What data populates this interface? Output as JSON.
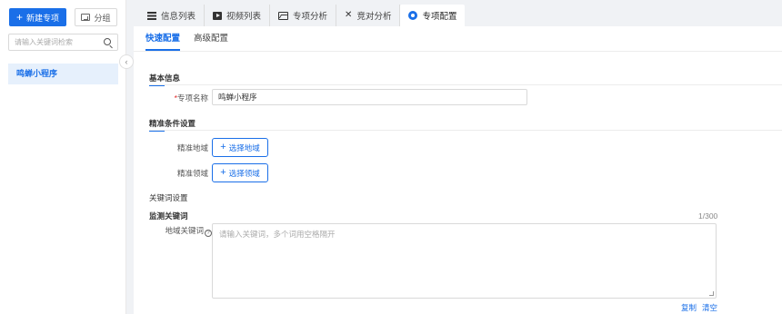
{
  "sidebar": {
    "new_button": "新建专项",
    "group_button": "分组",
    "search_placeholder": "请输入关键词检索",
    "items": [
      {
        "label": "鸣蝉小程序"
      }
    ]
  },
  "tabs": [
    {
      "label": "信息列表",
      "icon": "list-icon"
    },
    {
      "label": "视频列表",
      "icon": "video-icon"
    },
    {
      "label": "专项分析",
      "icon": "chart-icon"
    },
    {
      "label": "竞对分析",
      "icon": "versus-icon"
    },
    {
      "label": "专项配置",
      "icon": "settings-icon",
      "active": true
    }
  ],
  "subtabs": [
    {
      "label": "快速配置",
      "active": true
    },
    {
      "label": "高级配置"
    }
  ],
  "basic_info": {
    "title": "基本信息",
    "name_label": "专项名称",
    "name_required": "*",
    "name_value": "鸣蝉小程序"
  },
  "precise": {
    "title": "精准条件设置",
    "region_label": "精准地域",
    "region_button": "选择地域",
    "field_label": "精准领域",
    "field_button": "选择领域"
  },
  "keywords": {
    "title": "关键词设置",
    "monitor_title": "监测关键词",
    "counter": "1/300",
    "region_kw_label": "地域关键词",
    "placeholder": "请输入关键词，多个词用空格隔开",
    "copy": "复制",
    "clear": "清空"
  },
  "colors": {
    "accent": "#1a6fe8",
    "required": "#e02020"
  }
}
